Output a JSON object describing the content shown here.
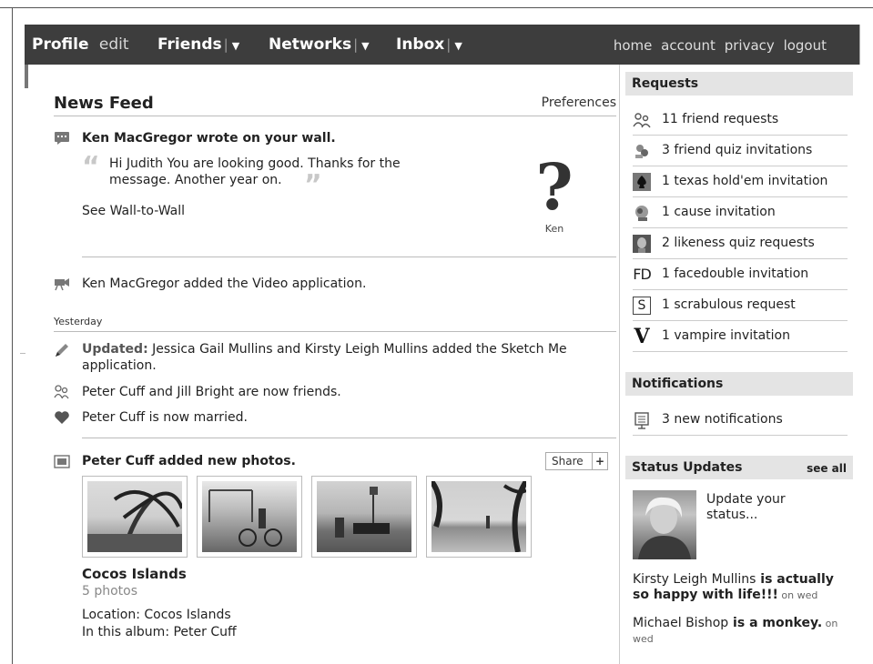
{
  "topbar": {
    "profile": "Profile",
    "edit": "edit",
    "friends": "Friends",
    "networks": "Networks",
    "inbox": "Inbox",
    "right_links": [
      "home",
      "account",
      "privacy",
      "logout"
    ]
  },
  "feed": {
    "title": "News Feed",
    "preferences": "Preferences",
    "wall_post": {
      "headline": "Ken MacGregor wrote on your wall.",
      "line1": "Hi Judith You are looking good. Thanks for the",
      "line2": "message. Another year on.",
      "link": "See Wall-to-Wall",
      "avatar_name": "Ken"
    },
    "video_story": "Ken MacGregor added the Video application.",
    "section_yesterday": "Yesterday",
    "sketch_prefix": "Updated:",
    "sketch_line1": " Jessica Gail Mullins and Kirsty Leigh Mullins added the Sketch Me",
    "sketch_line2": "application.",
    "friends_story": "Peter Cuff and Jill Bright are now friends.",
    "married_story": "Peter Cuff is now married.",
    "photos_story": "Peter Cuff added new photos.",
    "share": "Share",
    "album": {
      "title": "Cocos Islands",
      "count": "5 photos",
      "location": "Location: Cocos Islands",
      "in_album": "In this album: Peter Cuff"
    }
  },
  "sidebar": {
    "requests_title": "Requests",
    "requests": [
      {
        "label": "11 friend requests",
        "icon": "friends-icon"
      },
      {
        "label": "3 friend quiz invitations",
        "icon": "quiz-icon"
      },
      {
        "label": "1 texas hold'em invitation",
        "icon": "spade-icon"
      },
      {
        "label": "1 cause invitation",
        "icon": "cause-icon"
      },
      {
        "label": "2 likeness quiz requests",
        "icon": "likeness-icon"
      },
      {
        "label": "1 facedouble invitation",
        "icon": "facedouble-icon"
      },
      {
        "label": "1 scrabulous request",
        "icon": "scrabulous-icon"
      },
      {
        "label": "1 vampire invitation",
        "icon": "vampire-icon"
      }
    ],
    "notifications_title": "Notifications",
    "notifications": "3 new notifications",
    "status_title": "Status Updates",
    "see_all": "see all",
    "update_status": "Update your status...",
    "status1_name": "Kirsty Leigh Mullins",
    "status1_text": " is actually so happy with life!!!",
    "status1_when": " on wed",
    "status2_name": "Michael Bishop",
    "status2_text": " is a monkey.",
    "status2_when": " on wed"
  }
}
